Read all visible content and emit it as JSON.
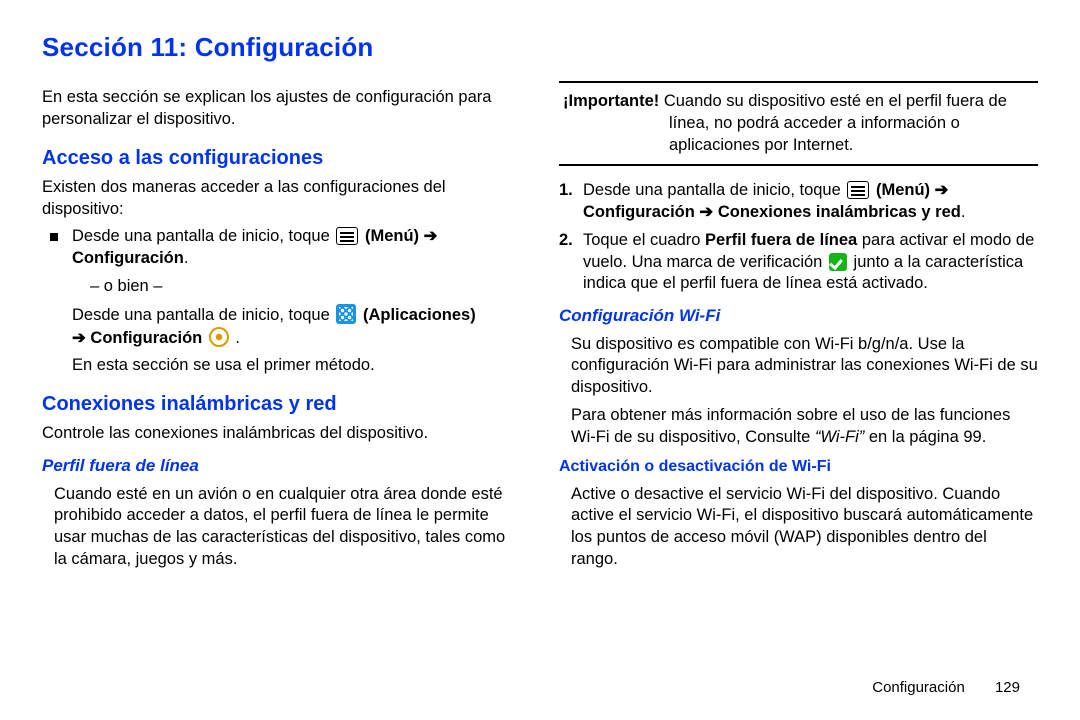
{
  "section_title": "Sección 11: Configuración",
  "left": {
    "intro": "En esta sección se explican los ajustes de configuración para personalizar el dispositivo.",
    "h_access": "Acceso a las configuraciones",
    "access_intro": "Existen dos maneras acceder a las configuraciones del dispositivo:",
    "bullet_a_pre": "Desde una pantalla de inicio, toque ",
    "menu_label": " (Menú) ",
    "arrow": "➔",
    "config_word": "Configuración",
    "or_text": "– o bien –",
    "bullet_b_pre": "Desde una pantalla de inicio, toque ",
    "apps_label": " (Aplicaciones)",
    "arrow2": " ➔ Configuración ",
    "period": ".",
    "method_note": "En esta sección se usa el primer método.",
    "h_wireless": "Conexiones inalámbricas y red",
    "wireless_intro": "Controle las conexiones inalámbricas del dispositivo.",
    "h_offline": "Perfil fuera de línea",
    "offline_body": "Cuando esté en un avión o en cualquier otra área donde esté prohibido acceder a datos, el perfil fuera de línea le permite usar muchas de las características del dispositivo, tales como la cámara, juegos y más."
  },
  "right": {
    "note_label": "¡Importante! ",
    "note_line1_rest": "Cuando su dispositivo esté en el perfil fuera de",
    "note_line2": "línea, no podrá acceder a información o",
    "note_line3": "aplicaciones por Internet.",
    "step1_num": "1.",
    "step1_pre": "Desde una pantalla de inicio, toque ",
    "step1_menu": " (Menú) ",
    "step1_arrow": "➔",
    "step1_line2": "Configuración ➔ Conexiones inalámbricas y red",
    "step2_num": "2.",
    "step2_a": "Toque el cuadro ",
    "step2_bold": "Perfil fuera de línea",
    "step2_b": " para activar el modo de vuelo. Una marca de verificación ",
    "step2_c": " junto a la característica indica que el perfil fuera de línea está activado.",
    "h_wifi": "Configuración Wi-Fi",
    "wifi_p1": "Su dispositivo es compatible con Wi-Fi b/g/n/a. Use la configuración Wi-Fi para administrar las conexiones Wi-Fi de su dispositivo.",
    "wifi_p2a": "Para obtener más información sobre el uso de las funciones Wi-Fi de su dispositivo, Consulte ",
    "wifi_ref": "“Wi-Fi”",
    "wifi_p2b": " en la página 99.",
    "h_wifi_toggle": "Activación o desactivación de Wi-Fi",
    "wifi_toggle_body": "Active o desactive el servicio Wi-Fi del dispositivo. Cuando active el servicio Wi-Fi, el dispositivo buscará automáticamente los puntos de acceso móvil (WAP) disponibles dentro del rango."
  },
  "footer": {
    "label": "Configuración",
    "page": "129"
  }
}
